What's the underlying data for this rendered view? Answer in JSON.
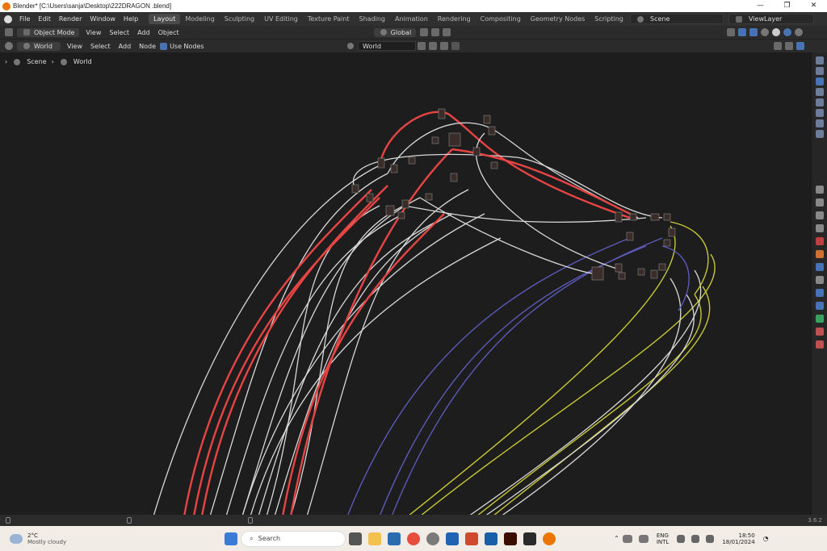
{
  "window": {
    "title": "Blender* [C:\\Users\\sanja\\Desktop\\222DRAGON .blend]",
    "min": "—",
    "max": "❐",
    "close": "✕"
  },
  "menu": [
    "File",
    "Edit",
    "Render",
    "Window",
    "Help"
  ],
  "workspaces": [
    "Layout",
    "Modeling",
    "Sculpting",
    "UV Editing",
    "Texture Paint",
    "Shading",
    "Animation",
    "Rendering",
    "Compositing",
    "Geometry Nodes",
    "Scripting"
  ],
  "add_workspace": "+",
  "scene": "Scene",
  "view_layer": "ViewLayer",
  "header": {
    "mode": "Object Mode",
    "menus": [
      "View",
      "Select",
      "Add",
      "Object"
    ],
    "transform": "Global"
  },
  "node_header": {
    "type": "World",
    "menus": [
      "View",
      "Select",
      "Add",
      "Node"
    ],
    "use_nodes": "Use Nodes",
    "world_name": "World"
  },
  "breadcrumb": [
    "Scene",
    "World"
  ],
  "version": "3.6.2",
  "taskbar": {
    "weather_temp": "2°C",
    "weather_text": "Mostly cloudy",
    "search": "Search",
    "lang1": "ENG",
    "lang2": "INTL",
    "time": "18:50",
    "date": "18/01/2024"
  },
  "colors": {
    "accent": "#4772b3",
    "wire_red": "#e84444",
    "wire_white": "#d8d8d8",
    "wire_purple": "#5a5ab8",
    "wire_yellow": "#c8c834"
  }
}
